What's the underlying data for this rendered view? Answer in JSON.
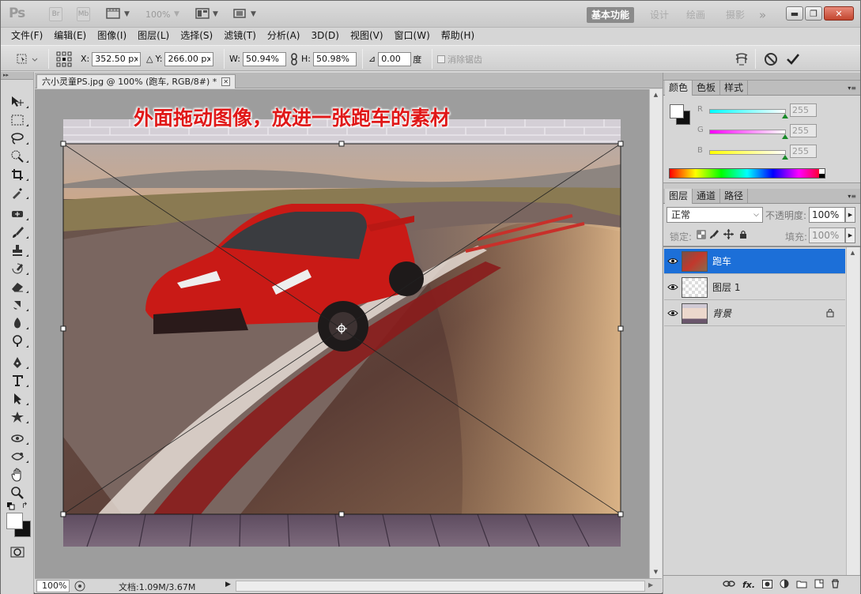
{
  "app": {
    "logo": "Ps",
    "bridge": "Br",
    "minibridge": "Mb",
    "zoom_display": "100%",
    "workspaces": [
      "基本功能",
      "设计",
      "绘画",
      "摄影"
    ],
    "more": "»",
    "win_min": "▬",
    "win_max": "❐",
    "win_close": "✕"
  },
  "menu": [
    "文件(F)",
    "编辑(E)",
    "图像(I)",
    "图层(L)",
    "选择(S)",
    "滤镜(T)",
    "分析(A)",
    "3D(D)",
    "视图(V)",
    "窗口(W)",
    "帮助(H)"
  ],
  "options": {
    "x_label": "X:",
    "x_value": "352.50 px",
    "y_label": "Y:",
    "y_value": "266.00 px",
    "w_label": "W:",
    "w_value": "50.94%",
    "h_label": "H:",
    "h_value": "50.98%",
    "angle_value": "0.00",
    "angle_unit": "度",
    "antialias_label": "消除锯齿"
  },
  "document": {
    "tab_title": "六小灵童PS.jpg @ 100% (跑车, RGB/8#) *",
    "annotation": "外面拖动图像，放进一张跑车的素材",
    "zoom": "100%",
    "doc_info": "文档:1.09M/3.67M"
  },
  "color_panel": {
    "tabs": [
      "颜色",
      "色板",
      "样式"
    ],
    "channels": [
      {
        "name": "R",
        "value": "255",
        "color": "#00e5e5"
      },
      {
        "name": "G",
        "value": "255",
        "color": "#e500e5"
      },
      {
        "name": "B",
        "value": "255",
        "color": "#e5e500"
      }
    ]
  },
  "layers_panel": {
    "tabs": [
      "图层",
      "通道",
      "路径"
    ],
    "blend_mode": "正常",
    "opacity_label": "不透明度:",
    "opacity_value": "100%",
    "lock_label": "锁定:",
    "fill_label": "填充:",
    "fill_value": "100%",
    "layers": [
      {
        "name": "跑车",
        "selected": true
      },
      {
        "name": "图层 1",
        "selected": false
      },
      {
        "name": "背景",
        "selected": false,
        "locked": true
      }
    ]
  },
  "colors": {
    "selection": "#1c6fd8",
    "annotation_text": "#e01818"
  }
}
